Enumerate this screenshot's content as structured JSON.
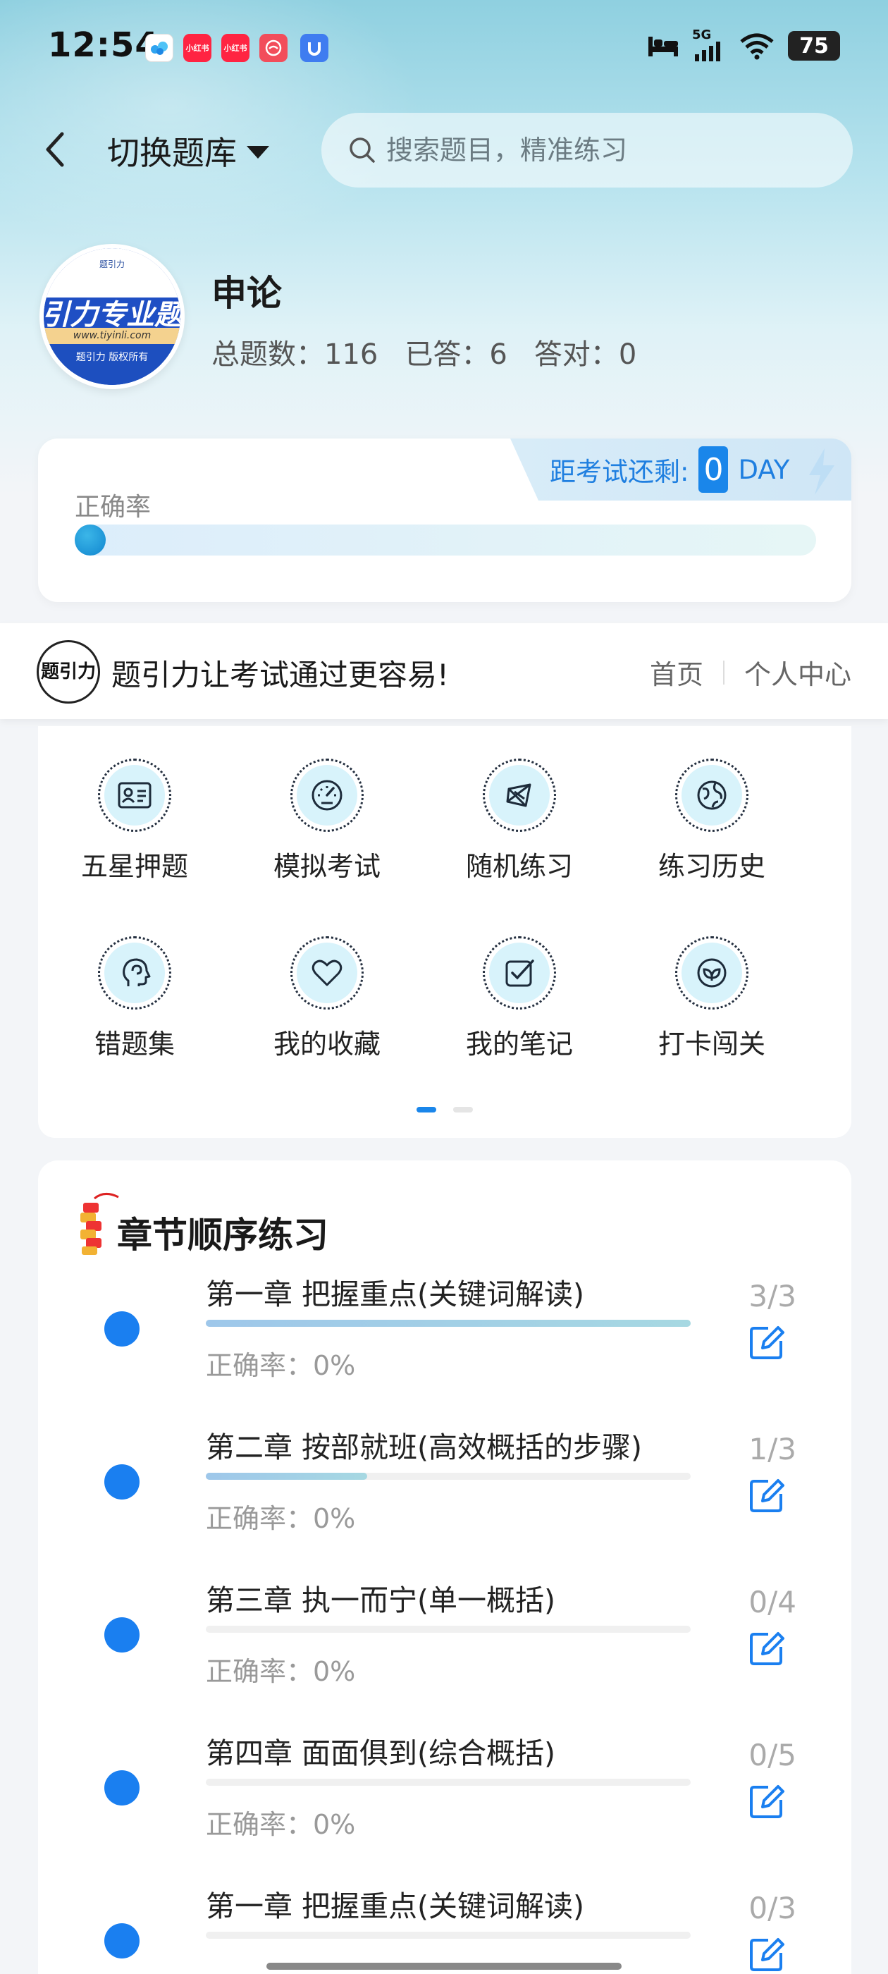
{
  "status_bar": {
    "time": "12:54",
    "notifications": [
      {
        "name": "baidu-netdisk-icon",
        "color": "#ffffff"
      },
      {
        "name": "xiaohongshu-icon",
        "color": "#ff2442",
        "text": "小红书"
      },
      {
        "name": "xiaohongshu-icon-2",
        "color": "#ff2442",
        "text": "小红书"
      },
      {
        "name": "app-icon",
        "color": "#f24d5b"
      },
      {
        "name": "app-icon-blue",
        "color": "#3f7cf0"
      }
    ],
    "network": "5G",
    "battery": "75"
  },
  "header": {
    "back_label": "",
    "switch_bank_label": "切换题库",
    "search_placeholder": "搜索题目，精准练习"
  },
  "profile": {
    "logo_band_text": "引力专业题",
    "logo_url_text": "www.tiyinli.com",
    "logo_copy_text": "题引力 版权所有",
    "logo_top_text": "题引力",
    "subject": "申论",
    "stats": [
      {
        "label": "总题数：",
        "value": "116"
      },
      {
        "label": "已答：",
        "value": "6"
      },
      {
        "label": "答对：",
        "value": "0"
      }
    ]
  },
  "accuracy": {
    "label": "正确率",
    "value": 0,
    "countdown_label": "距考试还剩:",
    "countdown_value": "0",
    "countdown_unit": "DAY"
  },
  "slogan": {
    "logo_text": "题引力",
    "text": "题引力让考试通过更容易!",
    "links": [
      "首页",
      "个人中心"
    ]
  },
  "features": [
    {
      "label": "五星押题",
      "icon": "id-card-icon"
    },
    {
      "label": "模拟考试",
      "icon": "speedometer-icon"
    },
    {
      "label": "随机练习",
      "icon": "random-network-icon"
    },
    {
      "label": "练习历史",
      "icon": "globe-icon"
    },
    {
      "label": "错题集",
      "icon": "head-brain-icon"
    },
    {
      "label": "我的收藏",
      "icon": "heart-icon"
    },
    {
      "label": "我的笔记",
      "icon": "note-check-icon"
    },
    {
      "label": "打卡闯关",
      "icon": "leaf-badge-icon"
    }
  ],
  "pager": {
    "active": 0,
    "total": 2
  },
  "chapters": {
    "heading": "章节顺序练习",
    "items": [
      {
        "title": "第一章 把握重点(关键词解读)",
        "accuracy": "正确率：0%",
        "count": "3/3",
        "progress": 1.0
      },
      {
        "title": "第二章 按部就班(高效概括的步骤)",
        "accuracy": "正确率：0%",
        "count": "1/3",
        "progress": 0.333
      },
      {
        "title": "第三章 执一而宁(单一概括)",
        "accuracy": "正确率：0%",
        "count": "0/4",
        "progress": 0
      },
      {
        "title": "第四章 面面俱到(综合概括)",
        "accuracy": "正确率：0%",
        "count": "0/5",
        "progress": 0
      },
      {
        "title": "第一章 把握重点(关键词解读)",
        "accuracy": "",
        "count": "0/3",
        "progress": 0
      }
    ]
  },
  "colors": {
    "accent": "#1a86ea",
    "chapter_dot": "#1a7ff0"
  }
}
